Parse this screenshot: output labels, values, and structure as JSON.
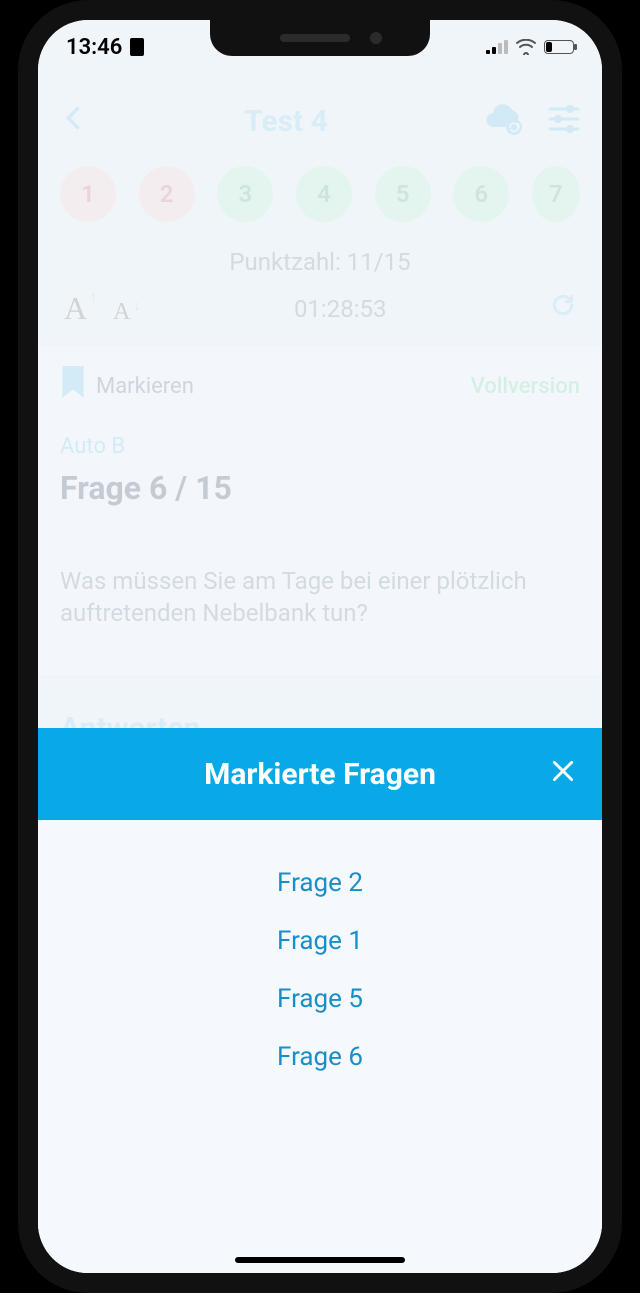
{
  "status": {
    "time": "13:46"
  },
  "header": {
    "title": "Test 4"
  },
  "questions": {
    "items": [
      {
        "n": "1",
        "state": "red"
      },
      {
        "n": "2",
        "state": "red"
      },
      {
        "n": "3",
        "state": "green"
      },
      {
        "n": "4",
        "state": "green"
      },
      {
        "n": "5",
        "state": "green"
      },
      {
        "n": "6",
        "state": "green"
      },
      {
        "n": "7",
        "state": "green"
      }
    ]
  },
  "score_label": "Punktzahl: 11/15",
  "timer": "01:28:53",
  "bookmark_label": "Markieren",
  "fullversion_label": "Vollversion",
  "category": "Auto B",
  "question_counter": "Frage 6 / 15",
  "question_text": "Was müssen Sie am Tage bei einer plötzlich auftretenden Nebelbank tun?",
  "answers_heading": "Antworten",
  "sheet": {
    "title": "Markierte Fragen",
    "items": [
      "Frage 2",
      "Frage 1",
      "Frage 5",
      "Frage 6"
    ]
  }
}
